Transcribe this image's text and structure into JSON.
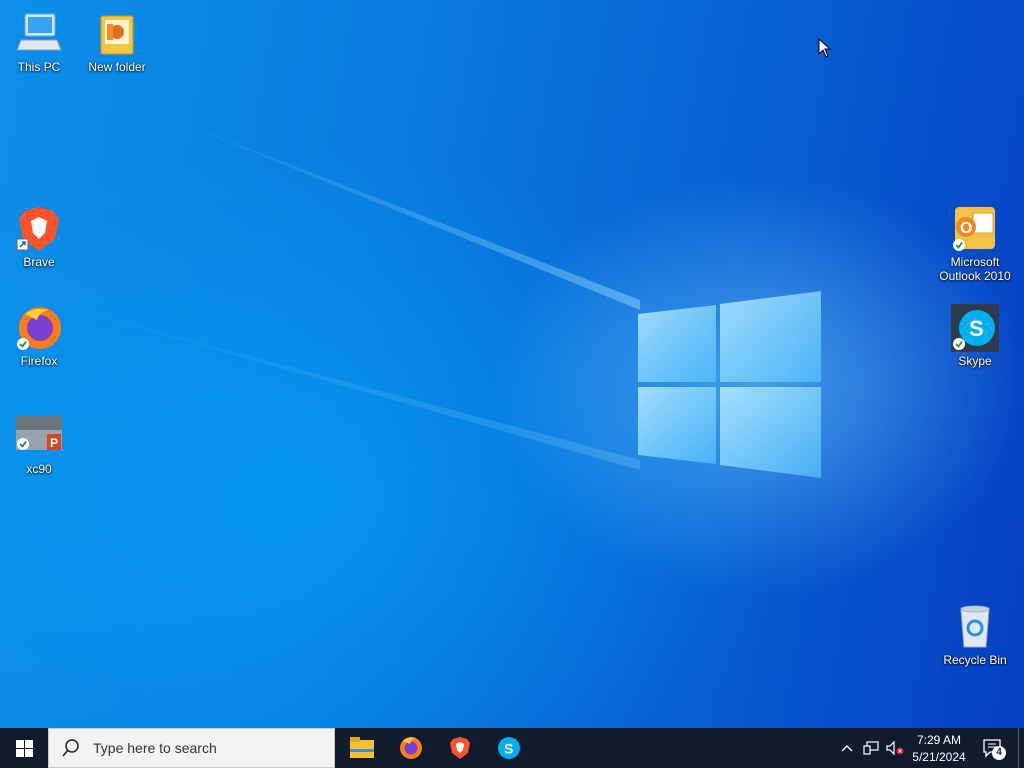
{
  "desktop": {
    "icons": [
      {
        "label": "This PC",
        "icon": "this-pc-icon"
      },
      {
        "label": "New folder",
        "icon": "folder-icon"
      },
      {
        "label": "Brave",
        "icon": "brave-icon"
      },
      {
        "label": "Firefox",
        "icon": "firefox-icon"
      },
      {
        "label": "xc90",
        "icon": "powerpoint-file-icon"
      },
      {
        "label": "Microsoft Outlook 2010",
        "icon": "outlook-icon"
      },
      {
        "label": "Skype",
        "icon": "skype-icon"
      },
      {
        "label": "Recycle Bin",
        "icon": "recycle-bin-icon"
      }
    ]
  },
  "taskbar": {
    "search_placeholder": "Type here to search",
    "pinned": [
      "file-explorer-icon",
      "firefox-icon",
      "brave-icon",
      "skype-icon"
    ],
    "clock": {
      "time": "7:29 AM",
      "date": "5/21/2024"
    },
    "notifications_count": "4"
  },
  "colors": {
    "taskbar_bg": "#101c2e",
    "desktop_blue": "#0a7de0"
  }
}
